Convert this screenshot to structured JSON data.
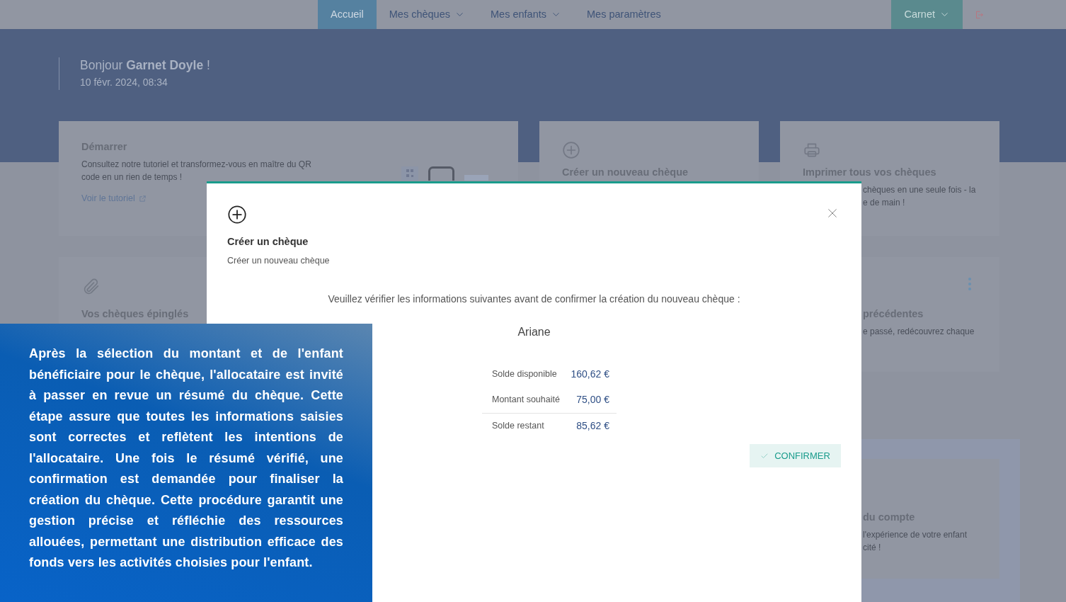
{
  "navbar": {
    "items": [
      {
        "label": "Accueil",
        "selected": true,
        "dropdown": false
      },
      {
        "label": "Mes chèques",
        "selected": false,
        "dropdown": true
      },
      {
        "label": "Mes enfants",
        "selected": false,
        "dropdown": true
      },
      {
        "label": "Mes paramètres",
        "selected": false,
        "dropdown": false
      }
    ],
    "account": {
      "label": "Carnet",
      "dropdown": true
    }
  },
  "header": {
    "greeting": "Bonjour **Garnet Doyle** !",
    "datetime": "10 févr. 2024, 08:34"
  },
  "cards": [
    {
      "kind": "tutorial",
      "title": "Démarrer",
      "text": "Consultez notre tutoriel et transformez-vous en maître du QR code en un rien de temps !",
      "link": "Voir le tutoriel"
    },
    {
      "kind": "create",
      "title": "Créer un nouveau chèque"
    },
    {
      "kind": "print",
      "title": "Imprimer tous vos chèques",
      "lines": [
        "chèques en une seule fois - la",
        "e de main !"
      ]
    },
    {
      "kind": "pinned",
      "title": "Vos chèques épinglés"
    },
    {
      "kind": "history",
      "title": "précédentes",
      "lines": [
        "e passé, redécouvrez chaque"
      ]
    },
    {
      "kind": "account",
      "title": "du compte",
      "lines": [
        "l'expérience de votre enfant",
        "cité !"
      ]
    }
  ],
  "modal": {
    "title": "Créer un chèque",
    "subtitle": "Créer un nouveau chèque",
    "message": "Veuillez vérifier les informations suivantes avant de confirmer la création du nouveau chèque :",
    "child": "Ariane",
    "rows": [
      {
        "label": "Solde disponible",
        "value": "160,62 €"
      },
      {
        "label": "Montant souhaité",
        "value": "75,00 €"
      },
      {
        "label": "Solde restant",
        "value": "85,62 €"
      }
    ],
    "confirm": "CONFIRMER"
  },
  "caption": {
    "text": "Après la sélection du montant et de l'enfant bénéficiaire pour le chèque, l'allocataire est invité à passer en revue un résumé du chèque. Cette étape assure que toutes les informations saisies sont correctes et reflètent les intentions de l'allocataire. Une fois le résumé vérifié, une confirmation est demandée pour finaliser la création du chèque. Cette procédure garantit une gestion précise et réfléchie des ressources allouées, permettant une distribution efficace des fonds vers les activités choisies pour l'enfant."
  }
}
